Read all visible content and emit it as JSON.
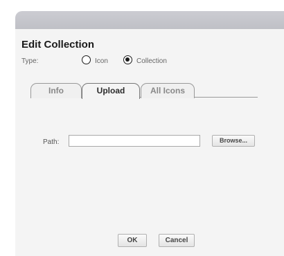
{
  "dialog": {
    "title": "Edit Collection"
  },
  "type_selector": {
    "label": "Type:",
    "options": [
      {
        "label": "Icon",
        "checked": false
      },
      {
        "label": "Collection",
        "checked": true
      }
    ]
  },
  "tabs": [
    {
      "label": "Info",
      "active": false
    },
    {
      "label": "Upload",
      "active": true
    },
    {
      "label": "All Icons",
      "active": false
    }
  ],
  "upload": {
    "path_label": "Path:",
    "path_value": "",
    "browse_label": "Browse..."
  },
  "footer": {
    "ok_label": "OK",
    "cancel_label": "Cancel"
  }
}
